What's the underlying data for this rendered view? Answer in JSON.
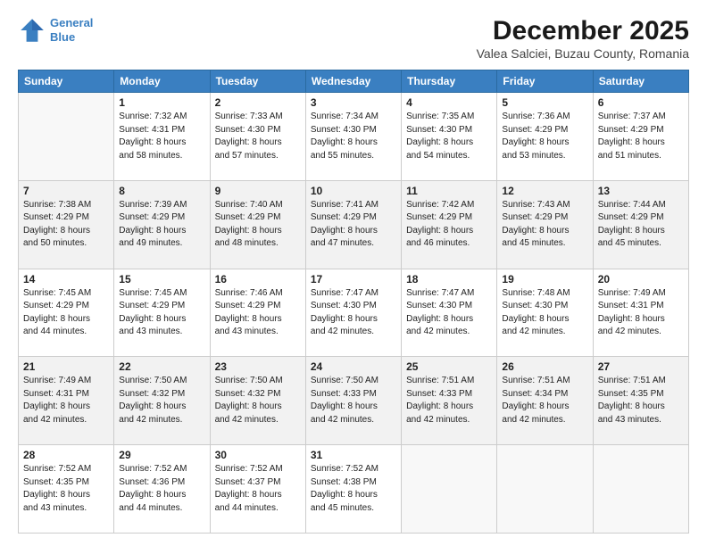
{
  "logo": {
    "line1": "General",
    "line2": "Blue"
  },
  "title": "December 2025",
  "subtitle": "Valea Salciei, Buzau County, Romania",
  "days_header": [
    "Sunday",
    "Monday",
    "Tuesday",
    "Wednesday",
    "Thursday",
    "Friday",
    "Saturday"
  ],
  "weeks": [
    [
      {
        "day": "",
        "info": ""
      },
      {
        "day": "1",
        "info": "Sunrise: 7:32 AM\nSunset: 4:31 PM\nDaylight: 8 hours\nand 58 minutes."
      },
      {
        "day": "2",
        "info": "Sunrise: 7:33 AM\nSunset: 4:30 PM\nDaylight: 8 hours\nand 57 minutes."
      },
      {
        "day": "3",
        "info": "Sunrise: 7:34 AM\nSunset: 4:30 PM\nDaylight: 8 hours\nand 55 minutes."
      },
      {
        "day": "4",
        "info": "Sunrise: 7:35 AM\nSunset: 4:30 PM\nDaylight: 8 hours\nand 54 minutes."
      },
      {
        "day": "5",
        "info": "Sunrise: 7:36 AM\nSunset: 4:29 PM\nDaylight: 8 hours\nand 53 minutes."
      },
      {
        "day": "6",
        "info": "Sunrise: 7:37 AM\nSunset: 4:29 PM\nDaylight: 8 hours\nand 51 minutes."
      }
    ],
    [
      {
        "day": "7",
        "info": "Sunrise: 7:38 AM\nSunset: 4:29 PM\nDaylight: 8 hours\nand 50 minutes."
      },
      {
        "day": "8",
        "info": "Sunrise: 7:39 AM\nSunset: 4:29 PM\nDaylight: 8 hours\nand 49 minutes."
      },
      {
        "day": "9",
        "info": "Sunrise: 7:40 AM\nSunset: 4:29 PM\nDaylight: 8 hours\nand 48 minutes."
      },
      {
        "day": "10",
        "info": "Sunrise: 7:41 AM\nSunset: 4:29 PM\nDaylight: 8 hours\nand 47 minutes."
      },
      {
        "day": "11",
        "info": "Sunrise: 7:42 AM\nSunset: 4:29 PM\nDaylight: 8 hours\nand 46 minutes."
      },
      {
        "day": "12",
        "info": "Sunrise: 7:43 AM\nSunset: 4:29 PM\nDaylight: 8 hours\nand 45 minutes."
      },
      {
        "day": "13",
        "info": "Sunrise: 7:44 AM\nSunset: 4:29 PM\nDaylight: 8 hours\nand 45 minutes."
      }
    ],
    [
      {
        "day": "14",
        "info": "Sunrise: 7:45 AM\nSunset: 4:29 PM\nDaylight: 8 hours\nand 44 minutes."
      },
      {
        "day": "15",
        "info": "Sunrise: 7:45 AM\nSunset: 4:29 PM\nDaylight: 8 hours\nand 43 minutes."
      },
      {
        "day": "16",
        "info": "Sunrise: 7:46 AM\nSunset: 4:29 PM\nDaylight: 8 hours\nand 43 minutes."
      },
      {
        "day": "17",
        "info": "Sunrise: 7:47 AM\nSunset: 4:30 PM\nDaylight: 8 hours\nand 42 minutes."
      },
      {
        "day": "18",
        "info": "Sunrise: 7:47 AM\nSunset: 4:30 PM\nDaylight: 8 hours\nand 42 minutes."
      },
      {
        "day": "19",
        "info": "Sunrise: 7:48 AM\nSunset: 4:30 PM\nDaylight: 8 hours\nand 42 minutes."
      },
      {
        "day": "20",
        "info": "Sunrise: 7:49 AM\nSunset: 4:31 PM\nDaylight: 8 hours\nand 42 minutes."
      }
    ],
    [
      {
        "day": "21",
        "info": "Sunrise: 7:49 AM\nSunset: 4:31 PM\nDaylight: 8 hours\nand 42 minutes."
      },
      {
        "day": "22",
        "info": "Sunrise: 7:50 AM\nSunset: 4:32 PM\nDaylight: 8 hours\nand 42 minutes."
      },
      {
        "day": "23",
        "info": "Sunrise: 7:50 AM\nSunset: 4:32 PM\nDaylight: 8 hours\nand 42 minutes."
      },
      {
        "day": "24",
        "info": "Sunrise: 7:50 AM\nSunset: 4:33 PM\nDaylight: 8 hours\nand 42 minutes."
      },
      {
        "day": "25",
        "info": "Sunrise: 7:51 AM\nSunset: 4:33 PM\nDaylight: 8 hours\nand 42 minutes."
      },
      {
        "day": "26",
        "info": "Sunrise: 7:51 AM\nSunset: 4:34 PM\nDaylight: 8 hours\nand 42 minutes."
      },
      {
        "day": "27",
        "info": "Sunrise: 7:51 AM\nSunset: 4:35 PM\nDaylight: 8 hours\nand 43 minutes."
      }
    ],
    [
      {
        "day": "28",
        "info": "Sunrise: 7:52 AM\nSunset: 4:35 PM\nDaylight: 8 hours\nand 43 minutes."
      },
      {
        "day": "29",
        "info": "Sunrise: 7:52 AM\nSunset: 4:36 PM\nDaylight: 8 hours\nand 44 minutes."
      },
      {
        "day": "30",
        "info": "Sunrise: 7:52 AM\nSunset: 4:37 PM\nDaylight: 8 hours\nand 44 minutes."
      },
      {
        "day": "31",
        "info": "Sunrise: 7:52 AM\nSunset: 4:38 PM\nDaylight: 8 hours\nand 45 minutes."
      },
      {
        "day": "",
        "info": ""
      },
      {
        "day": "",
        "info": ""
      },
      {
        "day": "",
        "info": ""
      }
    ]
  ]
}
